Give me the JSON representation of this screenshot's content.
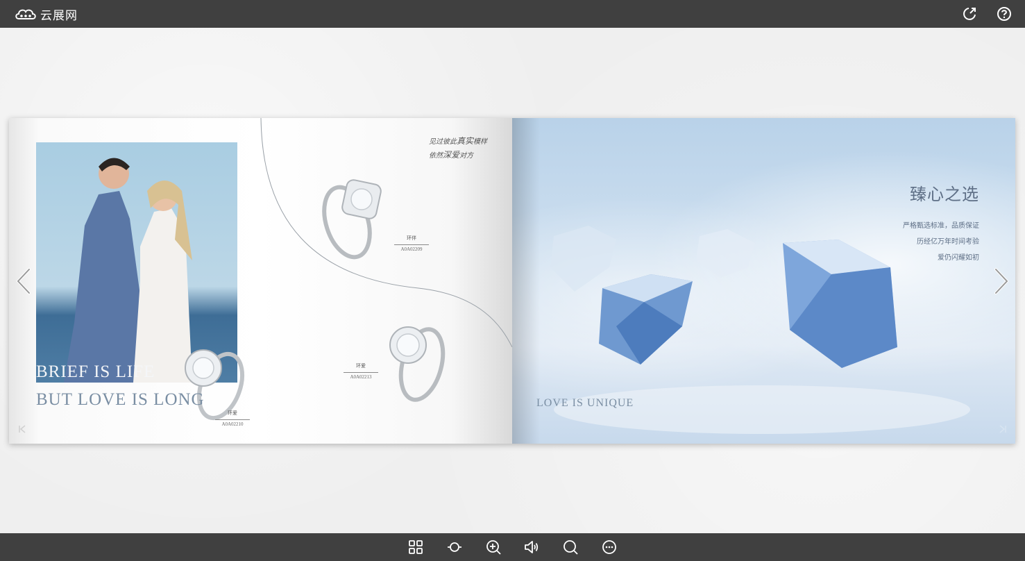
{
  "topbar": {
    "logo_text": "云展网",
    "share_icon": "share-external-icon",
    "help_icon": "help-circle-icon"
  },
  "book": {
    "left_page": {
      "poem_line1_a": "见过彼此",
      "poem_line1_b": "真实",
      "poem_line1_c": "模样",
      "poem_line2_a": "依然",
      "poem_line2_b": "深爱",
      "poem_line2_c": "对方",
      "title_line1": "BRIEF IS LIFE",
      "title_line2": "BUT LOVE IS LONG",
      "rings": [
        {
          "name": "环伴",
          "code": "A0A02209"
        },
        {
          "name": "环爱",
          "code": "A0A02213"
        },
        {
          "name": "环爱",
          "code": "A0A02210"
        }
      ]
    },
    "right_page": {
      "heading": "臻心之选",
      "lines": [
        "严格甄选标准，品质保证",
        "历经亿万年时间考验",
        "爱仍闪耀如初"
      ],
      "tagline": "LOVE IS UNIQUE"
    }
  },
  "toolbar": {
    "buttons": [
      "thumbnails-icon",
      "autoplay-icon",
      "zoom-in-icon",
      "sound-icon",
      "search-icon",
      "more-icon"
    ]
  },
  "colors": {
    "bar": "#404040",
    "title_blue": "#7a8ea3",
    "heading_blue": "#5e6f86"
  }
}
